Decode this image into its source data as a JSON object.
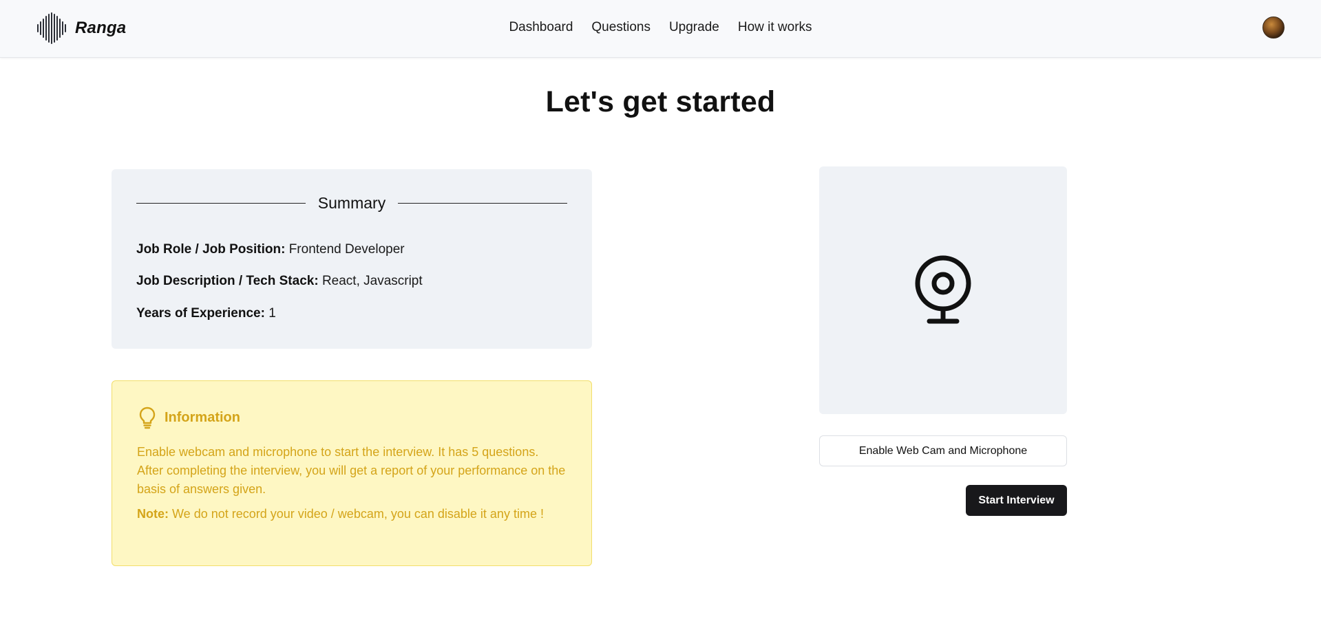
{
  "header": {
    "brand_name": "Ranga",
    "brand_icon": "soundwave-logo-icon",
    "nav": [
      {
        "label": "Dashboard"
      },
      {
        "label": "Questions"
      },
      {
        "label": "Upgrade"
      },
      {
        "label": "How it works"
      }
    ],
    "avatar_icon": "user-avatar"
  },
  "main": {
    "title": "Let's get started",
    "summary": {
      "heading": "Summary",
      "job_role_label": "Job Role / Job Position:",
      "job_role_value": "Frontend Developer",
      "job_desc_label": "Job Description / Tech Stack:",
      "job_desc_value": "React, Javascript",
      "experience_label": "Years of Experience:",
      "experience_value": "1"
    },
    "information": {
      "icon": "lightbulb-icon",
      "title": "Information",
      "text": "Enable webcam and microphone to start the interview. It has 5 questions. After completing the interview, you will get a report of your performance on the basis of answers given.",
      "note_label": "Note:",
      "note_text": "We do not record your video / webcam, you can disable it any time !"
    },
    "webcam": {
      "icon": "webcam-icon",
      "enable_label": "Enable Web Cam and Microphone",
      "start_label": "Start Interview"
    }
  },
  "colors": {
    "navbar_bg": "#f8f9fb",
    "card_bg": "#eff2f6",
    "info_bg": "#fef7c3",
    "info_text": "#d4a419",
    "primary_button": "#18181b"
  }
}
